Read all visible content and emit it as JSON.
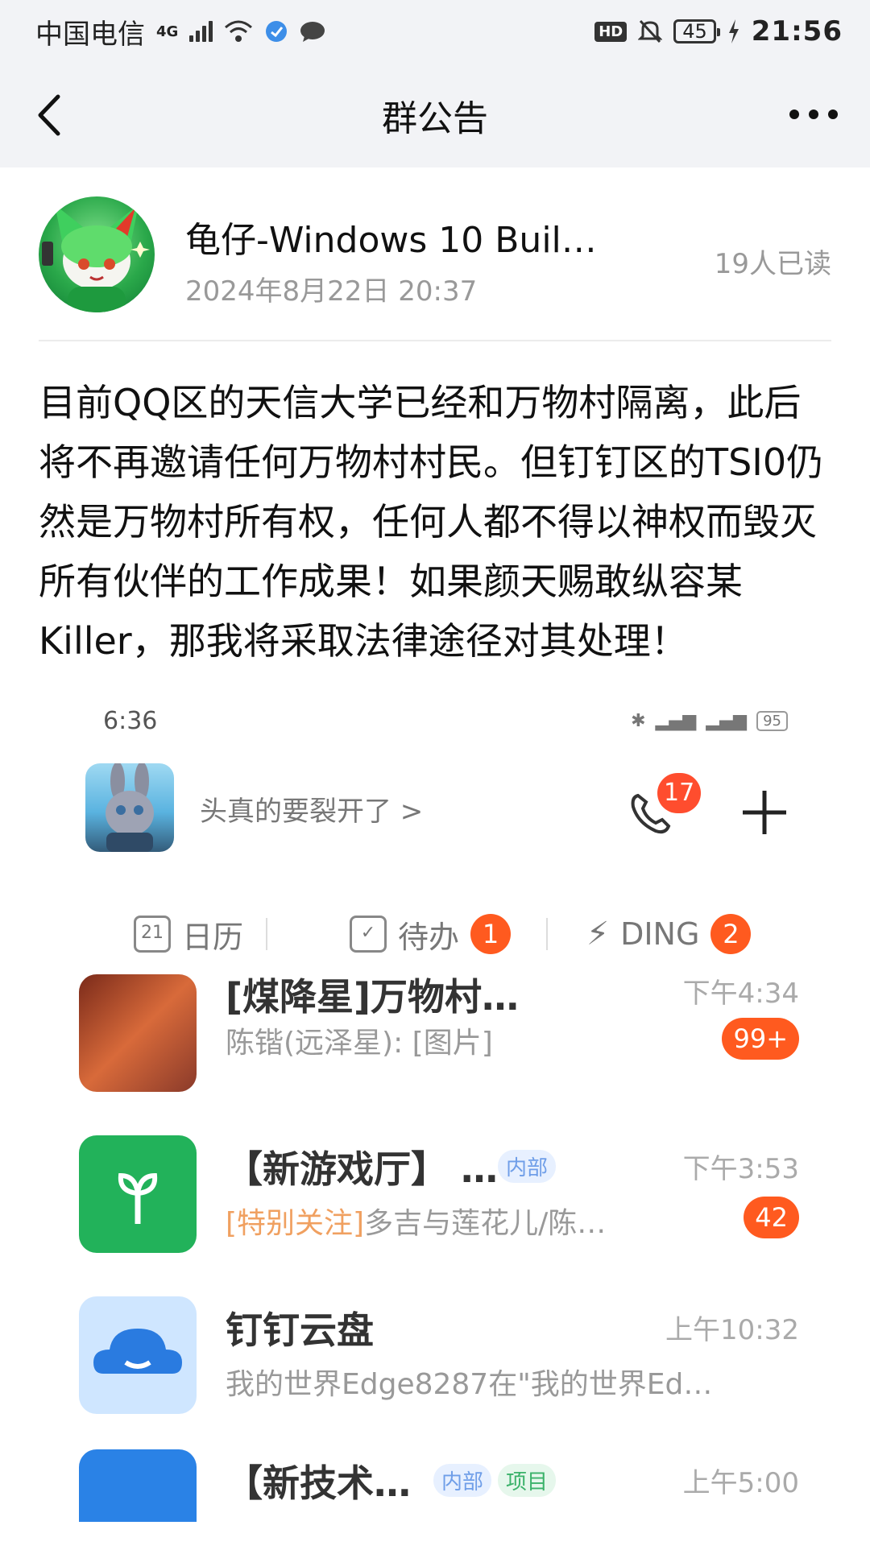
{
  "status_bar": {
    "carrier": "中国电信",
    "network": "4G",
    "hd": "HD",
    "battery": "45",
    "time": "21:56"
  },
  "nav": {
    "title": "群公告",
    "back_icon": "chevron-left-icon",
    "more_icon": "more-horizontal-icon"
  },
  "announcement": {
    "author_name": "龟仔-Windows 10 Buil…",
    "date": "2024年8月22日 20:37",
    "read_count": "19人已读",
    "text": "目前QQ区的天信大学已经和万物村隔离，此后将不再邀请任何万物村村民。但钉钉区的TSI0仍然是万物村所有权，任何人都不得以神权而毁灭所有伙伴的工作成果！如果颜天赐敢纵容某Killer，那我将采取法律途径对其处理！"
  },
  "embedded_screenshot": {
    "status_time": "6:36",
    "status_battery": "95",
    "user_status": "头真的要裂开了 >",
    "call_badge": "17",
    "tabs": [
      {
        "label": "日历",
        "icon_text": "21",
        "badge": ""
      },
      {
        "label": "待办",
        "icon_text": "✓",
        "badge": "1"
      },
      {
        "label": "DING",
        "icon_text": "⚡",
        "badge": "2"
      }
    ],
    "chats": [
      {
        "title": "[煤降星]万物村…",
        "subtitle": "陈锴(远泽星): [图片]",
        "highlight": "",
        "time": "下午4:34",
        "tag": "",
        "tag2": "",
        "unread": "99+"
      },
      {
        "title": "【新游戏厅】 …",
        "subtitle": "多吉与莲花儿/陈…",
        "highlight": "[特别关注]",
        "time": "下午3:53",
        "tag": "内部",
        "tag2": "",
        "unread": "42"
      },
      {
        "title": "钉钉云盘",
        "subtitle": "我的世界Edge8287在\"我的世界Ed…",
        "highlight": "",
        "time": "上午10:32",
        "tag": "",
        "tag2": "",
        "unread": ""
      },
      {
        "title": "【新技术…",
        "subtitle": "",
        "highlight": "",
        "time": "上午5:00",
        "tag": "内部",
        "tag2": "项目",
        "unread": ""
      }
    ]
  }
}
